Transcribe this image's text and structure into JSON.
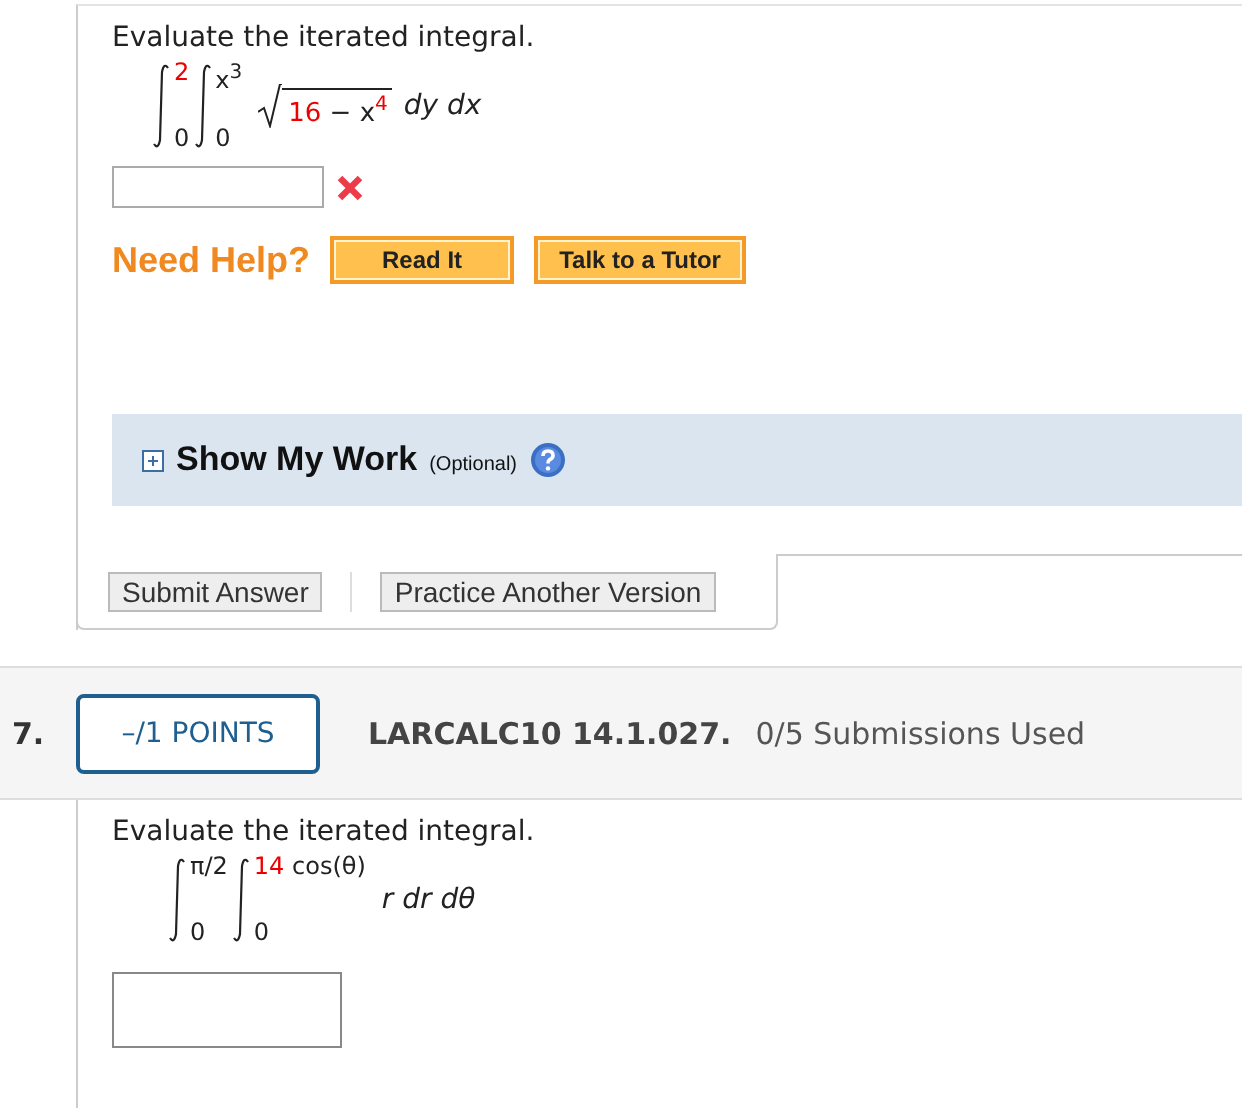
{
  "question_6": {
    "prompt": "Evaluate the iterated integral.",
    "integrals": [
      {
        "upper": [
          {
            "text": "2",
            "red": true
          }
        ],
        "lower": "0"
      },
      {
        "upper": [
          {
            "text": "x$^{3}$",
            "red": false
          }
        ],
        "lower": "0"
      }
    ],
    "radicand": [
      {
        "text": "16",
        "red": true
      },
      {
        "text": " − x",
        "red": false
      },
      {
        "text": "4",
        "red": true,
        "raised": true
      }
    ],
    "differentials": "dy dx",
    "answer": {
      "marked_wrong": true
    },
    "help_label": "Need Help?",
    "help_buttons": [
      "Read It",
      "Talk to a Tutor"
    ],
    "show_my_work": {
      "expanded": false,
      "label": "Show My Work",
      "note": "(Optional)"
    },
    "actions": [
      "Submit Answer",
      "Practice Another Version"
    ]
  },
  "question_7": {
    "number": "7.",
    "points": "–/1 POINTS",
    "code": "LARCALC10 14.1.027.",
    "submissions": "0/5 Submissions Used",
    "prompt": "Evaluate the iterated integral.",
    "integrals": [
      {
        "upper": [
          {
            "text": "π/2",
            "red": false
          }
        ],
        "lower": "0"
      },
      {
        "upper": [
          {
            "text": "14",
            "red": true
          },
          {
            "text": " cos(θ)",
            "red": false
          }
        ],
        "lower": "0"
      }
    ],
    "differentials": "r dr dθ",
    "answer": {
      "marked_wrong": false
    }
  }
}
